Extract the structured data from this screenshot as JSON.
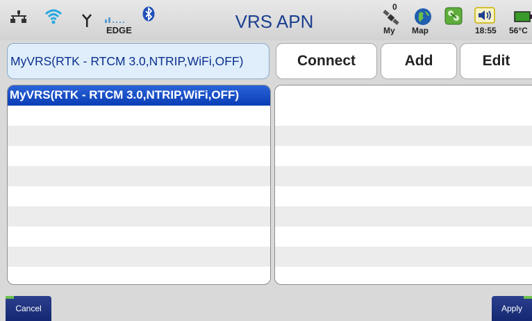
{
  "status_bar": {
    "title": "VRS APN",
    "network_type": "EDGE",
    "satellite_count": "0",
    "my_label": "My",
    "map_label": "Map",
    "time": "18:55",
    "temperature": "56°C",
    "icons": [
      "ethernet-icon",
      "wifi-icon",
      "antenna-icon",
      "signal-strength-icon",
      "bluetooth-icon",
      "satellite-icon",
      "map-globe-icon",
      "app-icon",
      "volume-icon",
      "battery-icon"
    ]
  },
  "profile_selector": {
    "value": "MyVRS(RTK - RTCM 3.0,NTRIP,WiFi,OFF)"
  },
  "buttons": {
    "connect": "Connect",
    "add": "Add",
    "edit": "Edit"
  },
  "profile_list": {
    "items": [
      "MyVRS(RTK - RTCM 3.0,NTRIP,WiFi,OFF)"
    ]
  },
  "soft_keys": {
    "cancel": "Cancel",
    "apply": "Apply"
  },
  "colors": {
    "title": "#1b3f8f",
    "selection": "#0a3db5",
    "softkey": "#142770",
    "battery": "#3a9a2a"
  }
}
